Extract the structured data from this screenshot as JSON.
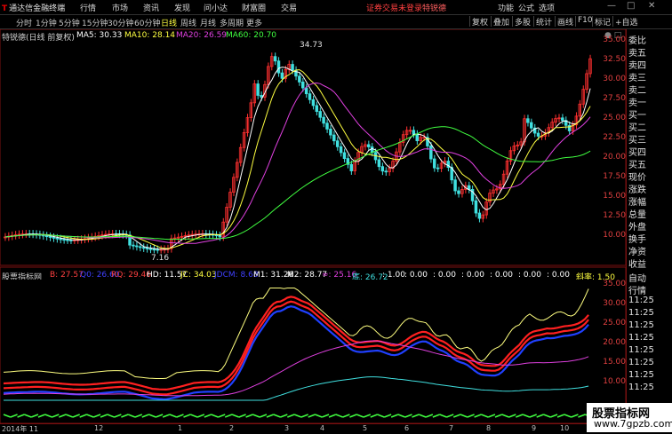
{
  "app": {
    "logo_mark": "T",
    "name": "通达信金融终端",
    "menus": [
      "行情",
      "市场",
      "资讯",
      "发现",
      "问小达",
      "财富圈",
      "交易"
    ],
    "notice": "证券交易未登录",
    "stock_name": "特锐德",
    "right_menus": [
      "功能",
      "公式",
      "选项"
    ]
  },
  "toolbar": {
    "periods": [
      "分时",
      "1分钟",
      "5分钟",
      "15分钟",
      "30分钟",
      "60分钟",
      "日线",
      "周线",
      "月线",
      "多周期",
      "更多"
    ],
    "active_period": "日线",
    "buttons": [
      "复权",
      "叠加",
      "多股",
      "统计",
      "画线",
      "F10",
      "标记",
      "+自选"
    ]
  },
  "main_chart": {
    "title": "特锐德(日线 前复权)",
    "ma": [
      {
        "label": "MA5: 30.33",
        "color": "#ffffff"
      },
      {
        "label": "MA10: 28.14",
        "color": "#ffff40"
      },
      {
        "label": "MA20: 26.59",
        "color": "#e040e0"
      },
      {
        "label": "MA60: 20.70",
        "color": "#40ff40"
      }
    ],
    "high_label": "34.73",
    "low_label": "7.16",
    "y_ticks": [
      "35.00",
      "32.50",
      "30.00",
      "27.50",
      "25.00",
      "22.50",
      "20.00",
      "17.50",
      "15.00",
      "12.50",
      "10.00"
    ]
  },
  "indicator": {
    "title": "股票指标网",
    "values": [
      {
        "label": "B: 27.57",
        "color": "#ff4040"
      },
      {
        "label": "Q0: 26.60",
        "color": "#4040ff"
      },
      {
        "label": "RQ: 29.46",
        "color": "#ff4040"
      },
      {
        "label": "HD: 11.57",
        "color": "#ffffff"
      },
      {
        "label": "JC: 34.03",
        "color": "#ffff40"
      },
      {
        "label": "JDCM: 8.68",
        "color": "#4040ff"
      },
      {
        "label": "M1: 31.26",
        "color": "#ffffff"
      },
      {
        "label": "M2: 28.77",
        "color": "#ffffff"
      },
      {
        "label": "≈: 25.16",
        "color": "#e040e0"
      },
      {
        "label": "底: 26.72",
        "color": "#40e0e0"
      },
      {
        "label": ": 1.00",
        "color": "#ffffff"
      },
      {
        "label": ": 0.00",
        "color": "#ffffff"
      },
      {
        "label": ": 0.00",
        "color": "#ffffff"
      },
      {
        "label": ": 0.00",
        "color": "#ffffff"
      },
      {
        "label": ": 0.00",
        "color": "#ffffff"
      },
      {
        "label": ": 0.00",
        "color": "#ffffff"
      },
      {
        "label": ": 0.00",
        "color": "#ffffff"
      },
      {
        "label": "斜率: 1.50",
        "color": "#ffff40"
      }
    ],
    "y_ticks": [
      "35.00",
      "30.00",
      "25.00",
      "20.00",
      "15.00",
      "10.00"
    ]
  },
  "right_panel": {
    "top": [
      "委比",
      "卖五",
      "卖四",
      "卖三",
      "卖二",
      "卖一",
      "买一",
      "买二",
      "买三",
      "买四",
      "买五",
      "现价",
      "涨跌",
      "涨幅",
      "总量",
      "外盘",
      "换手",
      "净资",
      "收益"
    ],
    "bottom": [
      "自动",
      "行情",
      "11:25",
      "11:25",
      "11:25",
      "11:25",
      "11:25",
      "11:25",
      "11:25",
      "11:25"
    ]
  },
  "date_axis": [
    "2014年 11",
    "12",
    "1",
    "2",
    "3",
    "4",
    "5",
    "6",
    "7",
    "8",
    "9",
    "10"
  ],
  "watermark": {
    "line1": "股票指标网",
    "line2": "www.7gpzb.com"
  }
}
